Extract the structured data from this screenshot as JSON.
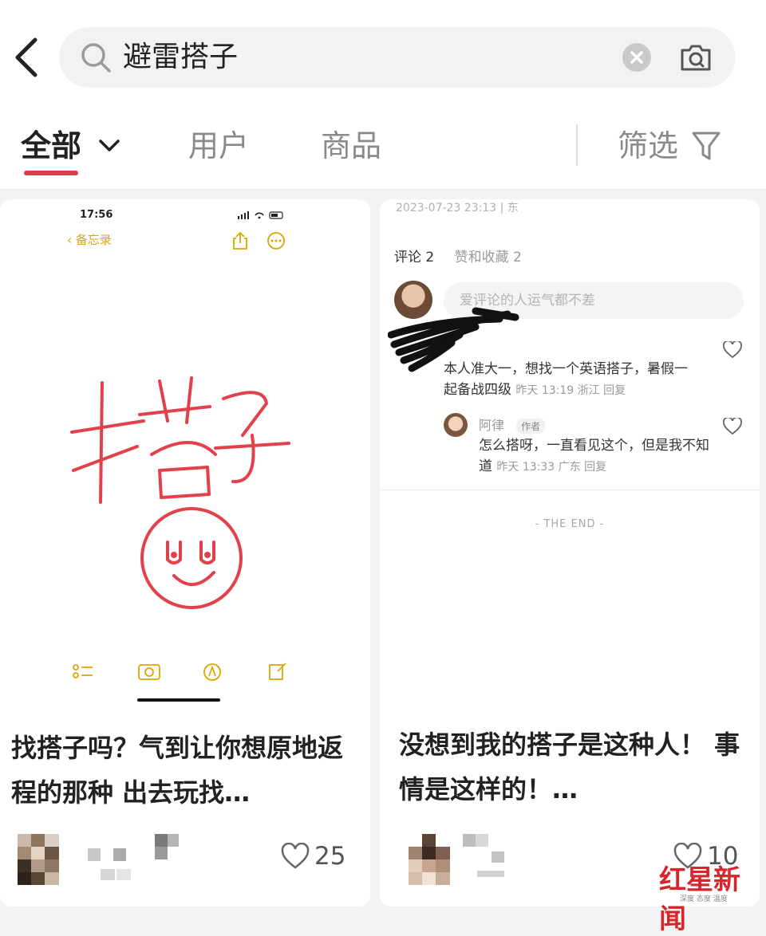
{
  "search": {
    "query": "避雷搭子"
  },
  "tabs": [
    {
      "label": "全部"
    },
    {
      "label": "用户"
    },
    {
      "label": "商品"
    },
    {
      "label": "筛选"
    }
  ],
  "accent": "#e23a48",
  "icons": {
    "back": "chevron-left-icon",
    "search": "search-icon",
    "clear": "clear-icon",
    "camera": "camera-icon",
    "filter": "filter-icon",
    "like": "heart-icon"
  },
  "posts": [
    {
      "title": "找搭子吗？气到让你想原地返程的那种 出去玩找…",
      "likes": "25",
      "cover": {
        "time": "17:56",
        "back_label": "备忘录",
        "drawing_text": "搭子"
      }
    },
    {
      "title": "没想到我的搭子是这种人！ 事情是这样的！…",
      "likes": "10",
      "cover": {
        "date": "2023-07-23 23:13 | 东",
        "comment_tab": "评论 2",
        "likes_tab": "赞和收藏 2",
        "input_placeholder": "爱评论的人运气都不差",
        "comment1_text": "本人准大一，想找一个英语搭子，暑假一起备战四级",
        "comment1_meta": "昨天 13:19 浙江 回复",
        "reply_author": "阿律",
        "reply_badge": "作者",
        "reply_text": "怎么搭呀，一直看见这个，但是我不知道",
        "reply_meta": "昨天 13:33 广东 回复",
        "end_mark": "- THE END -"
      }
    }
  ],
  "watermark": {
    "title": "红星新闻",
    "subtitle": "深度 态度 温度"
  }
}
